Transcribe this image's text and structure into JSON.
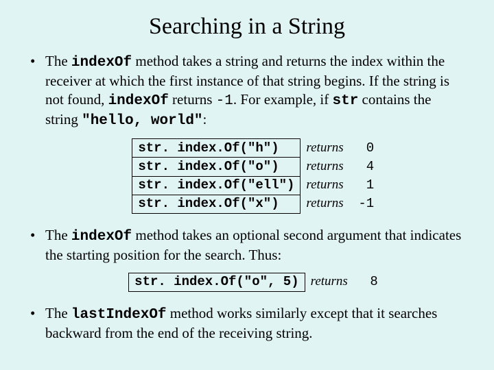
{
  "title": "Searching in a String",
  "bullets": {
    "b1_pre": "The ",
    "b1_code1": "indexOf",
    "b1_mid1": " method takes a string and returns the index within the receiver at which the first instance of that string begins.  If the string is not found, ",
    "b1_code2": "indexOf",
    "b1_mid2": " returns ",
    "b1_val": "-1",
    "b1_mid3": ".  For example, if ",
    "b1_code3": "str",
    "b1_mid4": " contains the string ",
    "b1_code4": "\"hello, world\"",
    "b1_tail": ":",
    "b2_pre": "The ",
    "b2_code1": "indexOf",
    "b2_tail": " method takes an optional second argument that indicates the starting position for the search.  Thus:",
    "b3_pre": "The ",
    "b3_code1": "lastIndexOf",
    "b3_tail": " method works similarly except that it searches backward from the end of the receiving string."
  },
  "returnsWord": "returns",
  "examples1": [
    {
      "call": "str. index.Of(\"h\")",
      "ret": "0"
    },
    {
      "call": "str. index.Of(\"o\")",
      "ret": "4"
    },
    {
      "call": "str. index.Of(\"ell\")",
      "ret": "1"
    },
    {
      "call": "str. index.Of(\"x\")",
      "ret": "-1"
    }
  ],
  "examples2": [
    {
      "call": "str. index.Of(\"o\", 5)",
      "ret": "8"
    }
  ]
}
